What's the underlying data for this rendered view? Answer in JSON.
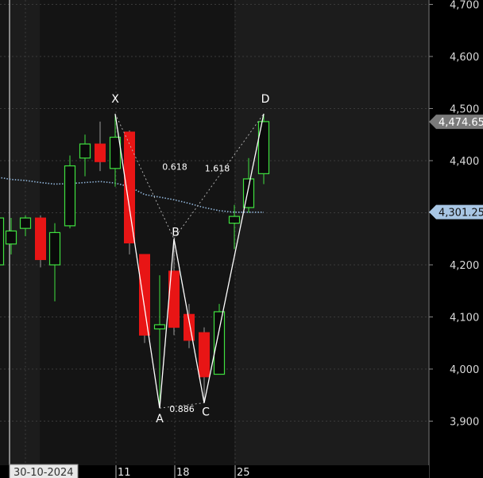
{
  "chart_data": {
    "type": "candlestick",
    "colors": {
      "bull_border": "#3fe03f",
      "bear_fill": "#e81515",
      "wick": "#9a9a9a",
      "moving_average": "#8fb4d9",
      "pattern_line": "#ffffff",
      "background": "#1c1c1c",
      "highlight_band": "#141414",
      "axis_panel": "#000000"
    },
    "y_axis": {
      "ylim": [
        3860,
        4705
      ],
      "ticks": [
        3900,
        4000,
        4100,
        4200,
        4300,
        4400,
        4500,
        4600,
        4700
      ],
      "tick_labels": [
        "3,900",
        "4,000",
        "4,100",
        "4,200",
        "4,300",
        "4,400",
        "4,500",
        "4,600",
        "4,700"
      ]
    },
    "x_axis": {
      "labels": [
        {
          "text": "11",
          "index": 8
        },
        {
          "text": "18",
          "index": 12
        },
        {
          "text": "25",
          "index": 16
        }
      ],
      "cursor_date": "30-10-2024"
    },
    "candles": [
      {
        "o": 4200,
        "h": 4300,
        "l": 4150,
        "c": 4290
      },
      {
        "o": 4240,
        "h": 4290,
        "l": 4220,
        "c": 4265
      },
      {
        "o": 4270,
        "h": 4295,
        "l": 4255,
        "c": 4290
      },
      {
        "o": 4290,
        "h": 4295,
        "l": 4195,
        "c": 4210
      },
      {
        "o": 4200,
        "h": 4280,
        "l": 4130,
        "c": 4262
      },
      {
        "o": 4275,
        "h": 4410,
        "l": 4270,
        "c": 4390
      },
      {
        "o": 4405,
        "h": 4450,
        "l": 4370,
        "c": 4432
      },
      {
        "o": 4432,
        "h": 4475,
        "l": 4380,
        "c": 4398
      },
      {
        "o": 4385,
        "h": 4490,
        "l": 4350,
        "c": 4445
      },
      {
        "o": 4455,
        "h": 4458,
        "l": 4220,
        "c": 4242
      },
      {
        "o": 4220,
        "h": 4220,
        "l": 4050,
        "c": 4065
      },
      {
        "o": 4077,
        "h": 4180,
        "l": 3925,
        "c": 4085
      },
      {
        "o": 4188,
        "h": 4250,
        "l": 4065,
        "c": 4080
      },
      {
        "o": 4105,
        "h": 4125,
        "l": 4040,
        "c": 4055
      },
      {
        "o": 4070,
        "h": 4080,
        "l": 3935,
        "c": 3985
      },
      {
        "o": 3990,
        "h": 4125,
        "l": 3990,
        "c": 4110
      },
      {
        "o": 4280,
        "h": 4315,
        "l": 4230,
        "c": 4293
      },
      {
        "o": 4310,
        "h": 4405,
        "l": 4300,
        "c": 4365
      },
      {
        "o": 4375,
        "h": 4490,
        "l": 4355,
        "c": 4475
      }
    ],
    "candle_x_positions": [
      -2,
      14,
      32,
      51,
      69,
      88,
      107,
      126,
      145,
      163,
      182,
      201,
      219,
      238,
      257,
      276,
      295,
      313,
      332
    ],
    "moving_average": [
      {
        "i": 0,
        "v": 4368
      },
      {
        "i": 1,
        "v": 4364
      },
      {
        "i": 2,
        "v": 4362
      },
      {
        "i": 3,
        "v": 4358
      },
      {
        "i": 4,
        "v": 4355
      },
      {
        "i": 5,
        "v": 4356
      },
      {
        "i": 6,
        "v": 4358
      },
      {
        "i": 7,
        "v": 4360
      },
      {
        "i": 8,
        "v": 4357
      },
      {
        "i": 9,
        "v": 4350
      },
      {
        "i": 10,
        "v": 4335
      },
      {
        "i": 11,
        "v": 4330
      },
      {
        "i": 12,
        "v": 4325
      },
      {
        "i": 13,
        "v": 4318
      },
      {
        "i": 14,
        "v": 4310
      },
      {
        "i": 15,
        "v": 4304
      },
      {
        "i": 16,
        "v": 4301
      },
      {
        "i": 17,
        "v": 4301
      },
      {
        "i": 18,
        "v": 4301
      }
    ],
    "pattern": {
      "points": [
        {
          "label": "X",
          "i": 8,
          "v": 4490
        },
        {
          "label": "A",
          "i": 11,
          "v": 3925
        },
        {
          "label": "B",
          "i": 12,
          "v": 4250
        },
        {
          "label": "C",
          "i": 14,
          "v": 3935
        },
        {
          "label": "D",
          "i": 18,
          "v": 4490
        }
      ],
      "ratios": [
        {
          "text": "0.618",
          "from": "X",
          "to": "B"
        },
        {
          "text": "0.886",
          "from": "A",
          "to": "C"
        },
        {
          "text": "1.618",
          "from": "B",
          "to": "D"
        }
      ]
    },
    "price_markers": [
      {
        "text": "4,474.65",
        "value": 4474.65
      },
      {
        "text": "4,301.25",
        "value": 4301.25
      }
    ],
    "grid": true
  }
}
